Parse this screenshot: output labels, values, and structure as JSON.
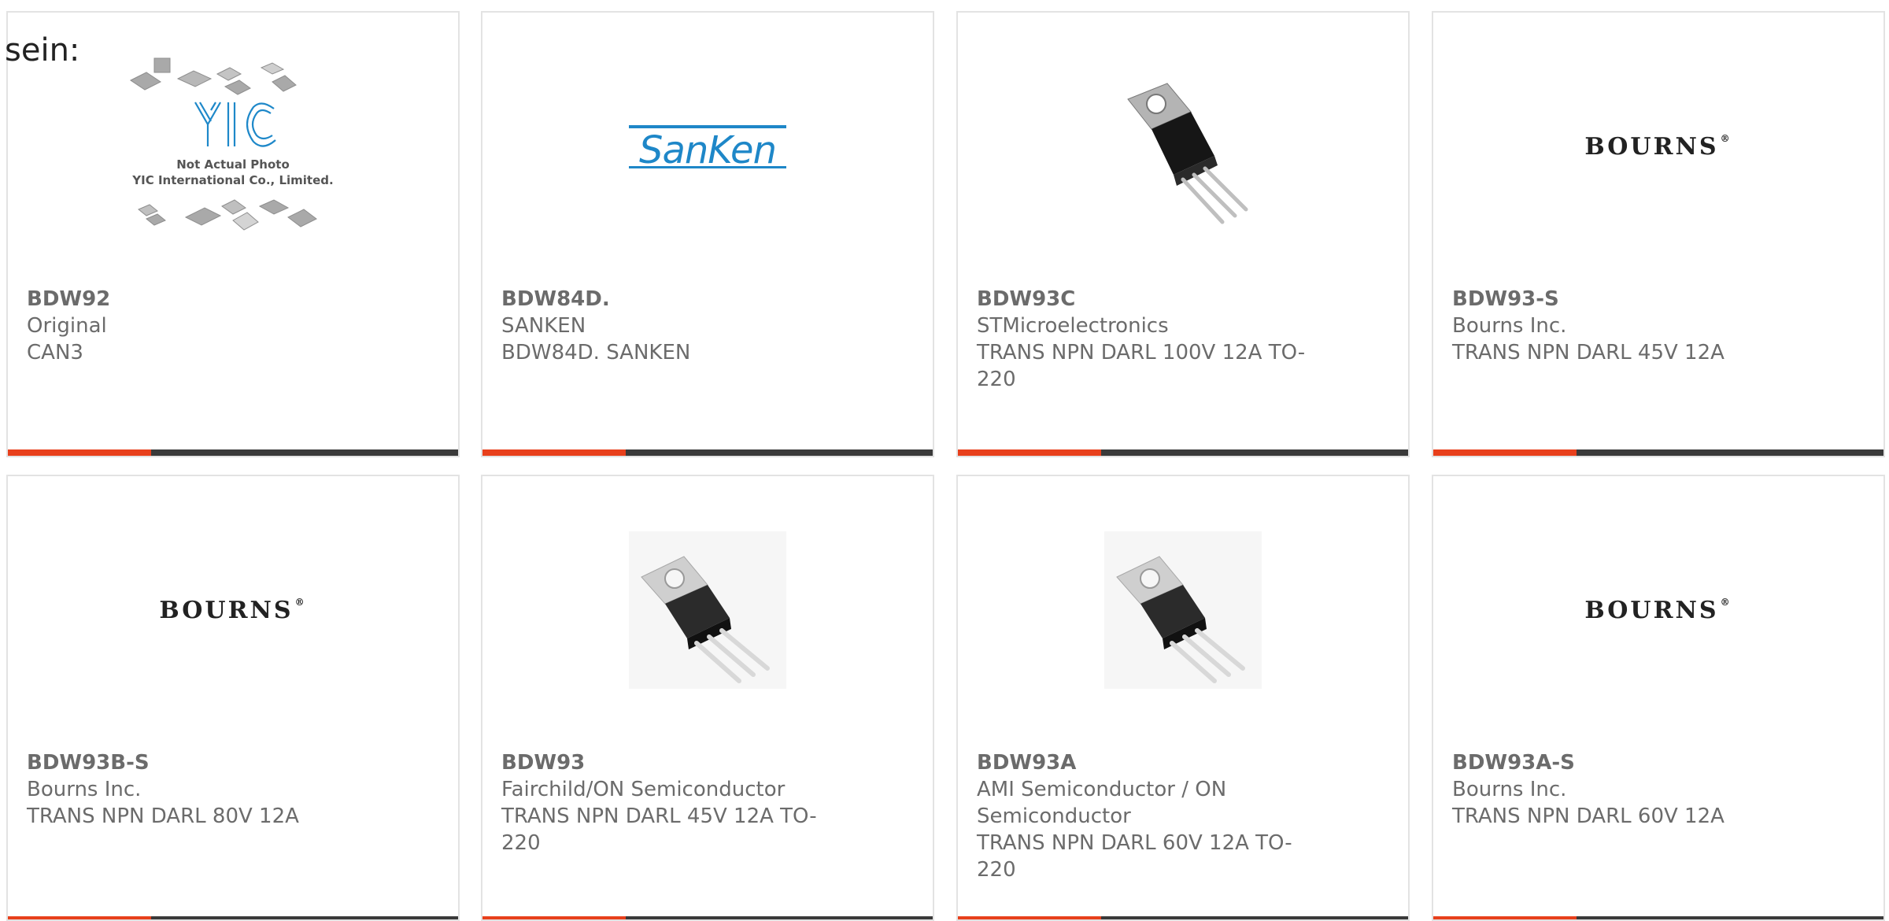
{
  "intro_text": "sein:",
  "colors": {
    "accent": "#e8401c",
    "bar": "#3a3a3a",
    "sanken_blue": "#1e87c8",
    "yic_blue": "#1e88c9"
  },
  "yic_photo": {
    "line1": "Not Actual Photo",
    "line2": "YIC International Co., Limited."
  },
  "logos": {
    "sanken": "SanKen",
    "bourns": "BOURNS",
    "bourns_mark": "®"
  },
  "products": [
    {
      "pn": "BDW92",
      "mfr": "Original",
      "desc": "CAN3",
      "image": "yic-placeholder"
    },
    {
      "pn": "BDW84D.",
      "mfr": "SANKEN",
      "desc": "BDW84D. SANKEN",
      "image": "sanken-logo"
    },
    {
      "pn": "BDW93C",
      "mfr": "STMicroelectronics",
      "desc": "TRANS NPN DARL 100V 12A TO-220",
      "image": "to220-photo"
    },
    {
      "pn": "BDW93-S",
      "mfr": "Bourns Inc.",
      "desc": "TRANS NPN DARL 45V 12A",
      "image": "bourns-logo"
    },
    {
      "pn": "BDW93B-S",
      "mfr": "Bourns Inc.",
      "desc": "TRANS NPN DARL 80V 12A",
      "image": "bourns-logo"
    },
    {
      "pn": "BDW93",
      "mfr": "Fairchild/ON Semiconductor",
      "desc": "TRANS NPN DARL 45V 12A TO-220",
      "image": "to220-render"
    },
    {
      "pn": "BDW93A",
      "mfr": "AMI Semiconductor / ON Semiconductor",
      "desc": "TRANS NPN DARL 60V 12A TO-220",
      "image": "to220-render"
    },
    {
      "pn": "BDW93A-S",
      "mfr": "Bourns Inc.",
      "desc": "TRANS NPN DARL 60V 12A",
      "image": "bourns-logo"
    }
  ]
}
